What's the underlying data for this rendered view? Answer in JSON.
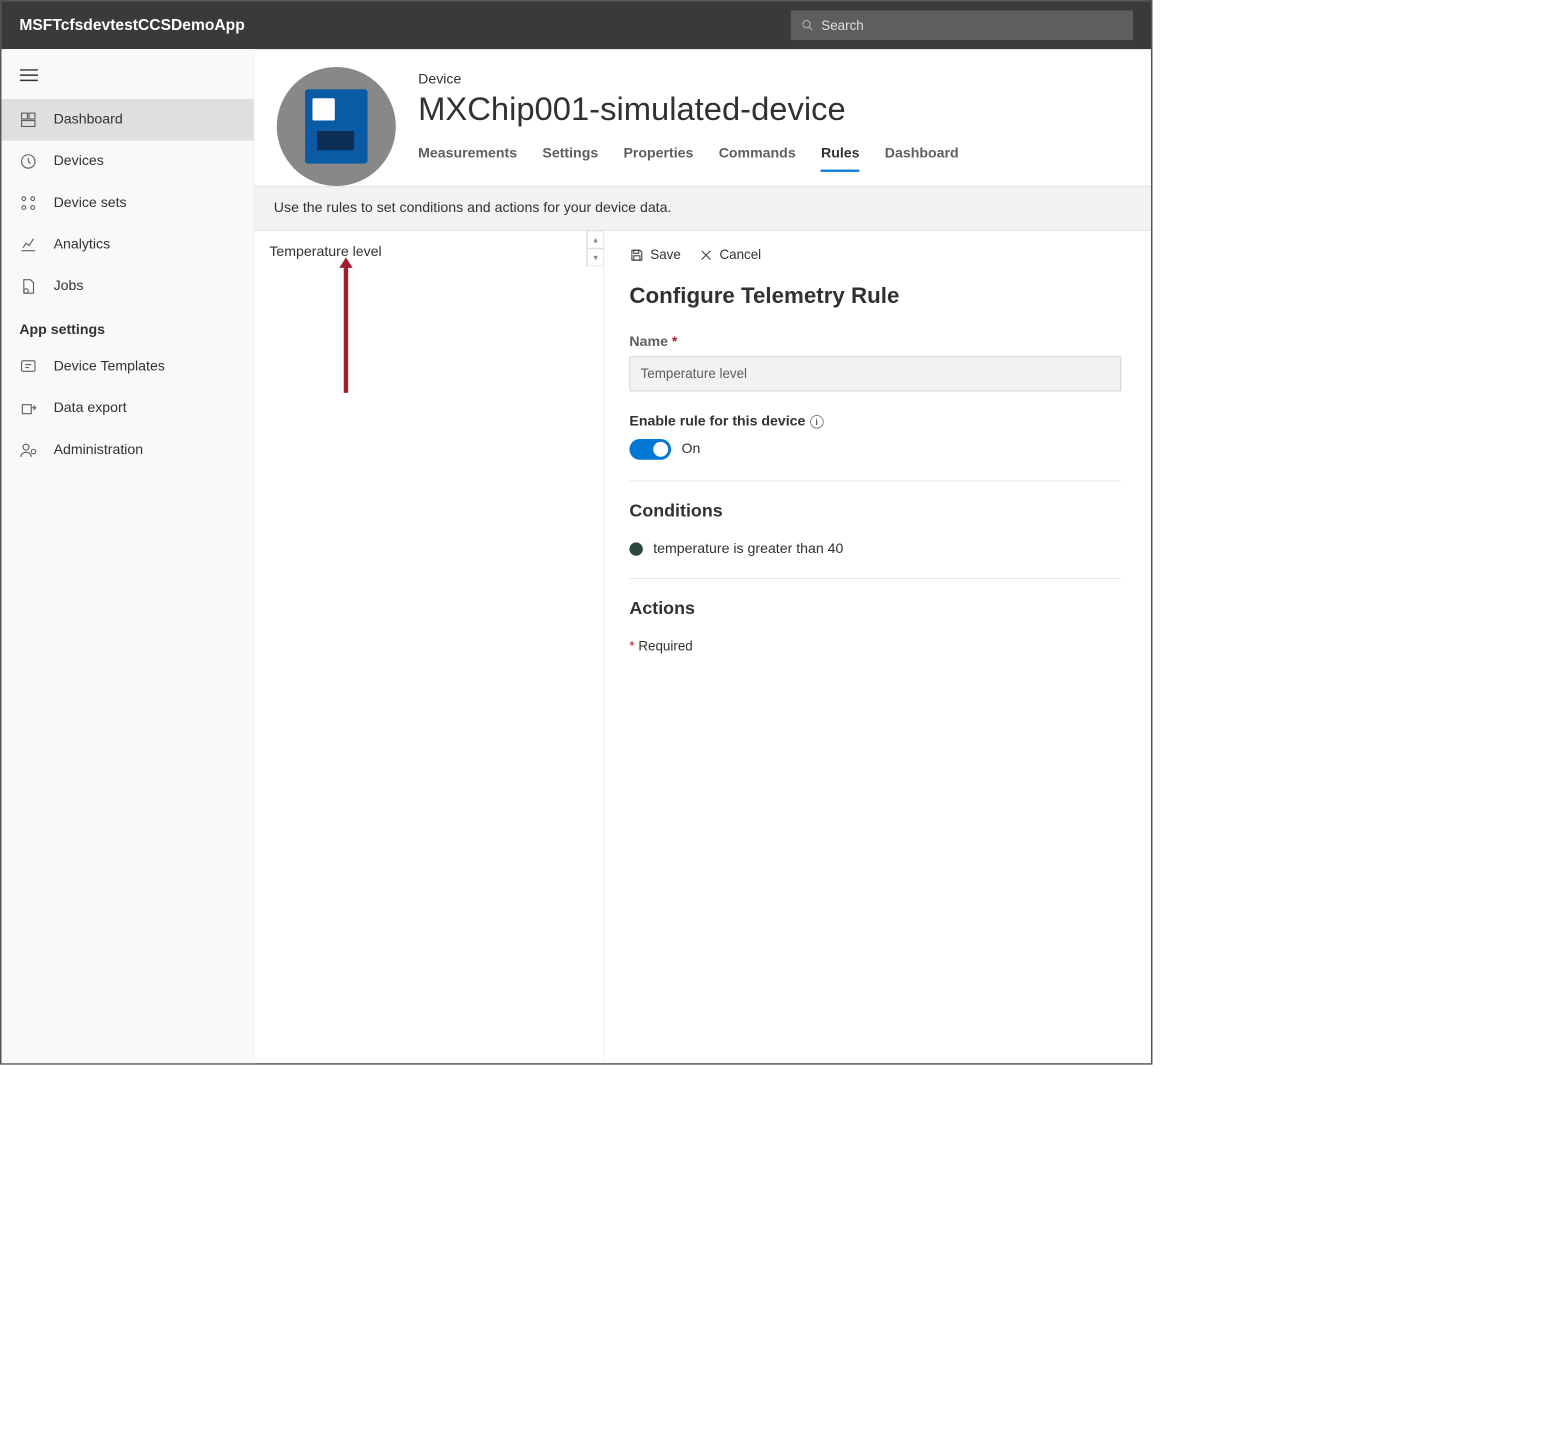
{
  "header": {
    "app_title": "MSFTcfsdevtestCCSDemoApp",
    "search_placeholder": "Search"
  },
  "sidebar": {
    "items": [
      {
        "label": "Dashboard"
      },
      {
        "label": "Devices"
      },
      {
        "label": "Device sets"
      },
      {
        "label": "Analytics"
      },
      {
        "label": "Jobs"
      }
    ],
    "settings_header": "App settings",
    "settings_items": [
      {
        "label": "Device Templates"
      },
      {
        "label": "Data export"
      },
      {
        "label": "Administration"
      }
    ]
  },
  "device": {
    "breadcrumb": "Device",
    "name": "MXChip001-simulated-device",
    "tabs": [
      {
        "label": "Measurements"
      },
      {
        "label": "Settings"
      },
      {
        "label": "Properties"
      },
      {
        "label": "Commands"
      },
      {
        "label": "Rules",
        "active": true
      },
      {
        "label": "Dashboard"
      }
    ]
  },
  "instruction": "Use the rules to set conditions and actions for your device data.",
  "rule_list": {
    "items": [
      {
        "label": "Temperature level"
      }
    ]
  },
  "rule_detail": {
    "save_label": "Save",
    "cancel_label": "Cancel",
    "title": "Configure Telemetry Rule",
    "name_label": "Name",
    "name_value": "Temperature level",
    "enable_label": "Enable rule for this device",
    "toggle_state": "On",
    "conditions_header": "Conditions",
    "condition_text": "temperature is greater than 40",
    "actions_header": "Actions",
    "required_text": "Required"
  }
}
